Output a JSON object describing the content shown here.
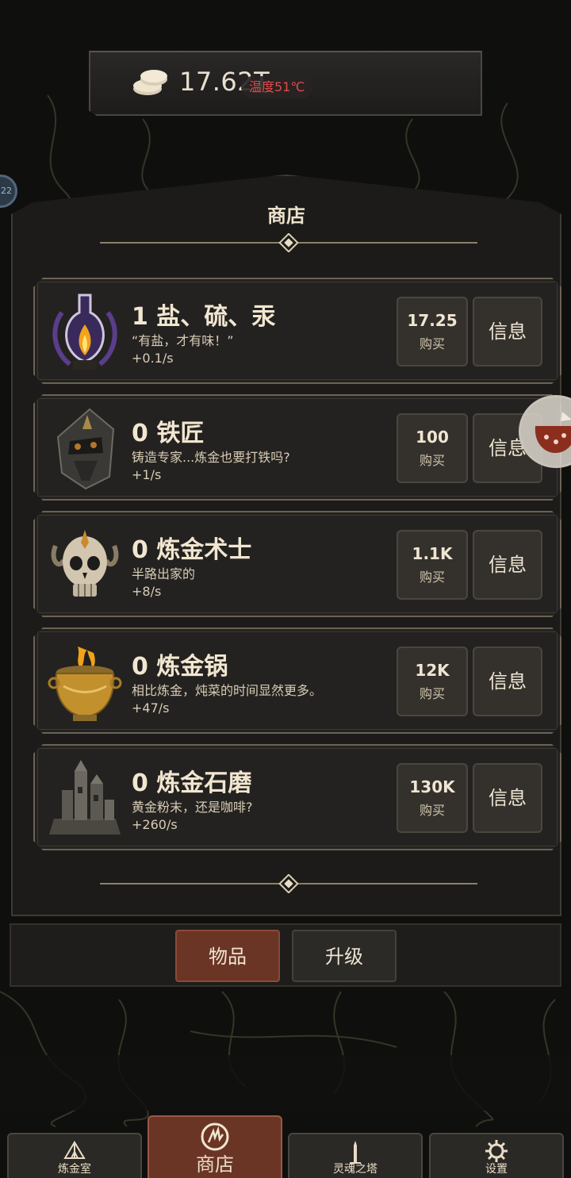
{
  "header": {
    "currency_value": "17.62T",
    "temperature": "温度51℃"
  },
  "side_badge": "22",
  "shop": {
    "title": "商店",
    "items": [
      {
        "count_name": "1 盐、硫、汞",
        "description": "“有盐，才有味！”",
        "rate": "+0.1/s",
        "price": "17.25",
        "buy_label": "购买",
        "info_label": "信息",
        "icon": "alchemy-flask-icon"
      },
      {
        "count_name": "0 铁匠",
        "description": "铸造专家...炼金也要打铁吗?",
        "rate": "+1/s",
        "price": "100",
        "buy_label": "购买",
        "info_label": "信息",
        "icon": "blacksmith-helmet-icon"
      },
      {
        "count_name": "0 炼金术士",
        "description": "半路出家的",
        "rate": "+8/s",
        "price": "1.1K",
        "buy_label": "购买",
        "info_label": "信息",
        "icon": "skull-icon"
      },
      {
        "count_name": "0 炼金锅",
        "description": "相比炼金，炖菜的时间显然更多。",
        "rate": "+47/s",
        "price": "12K",
        "buy_label": "购买",
        "info_label": "信息",
        "icon": "golden-cauldron-icon"
      },
      {
        "count_name": "0 炼金石磨",
        "description": "黄金粉末，还是咖啡?",
        "rate": "+260/s",
        "price": "130K",
        "buy_label": "购买",
        "info_label": "信息",
        "icon": "stone-tower-icon"
      }
    ]
  },
  "tabs": {
    "items": "物品",
    "upgrade": "升级"
  },
  "nav": {
    "lab": "炼金室",
    "shop": "商店",
    "tower": "灵魂之塔",
    "settings": "设置"
  },
  "colors": {
    "accent": "#6b3526",
    "panel": "#242220",
    "border": "#6b6253",
    "temperature": "#e24a4a"
  }
}
